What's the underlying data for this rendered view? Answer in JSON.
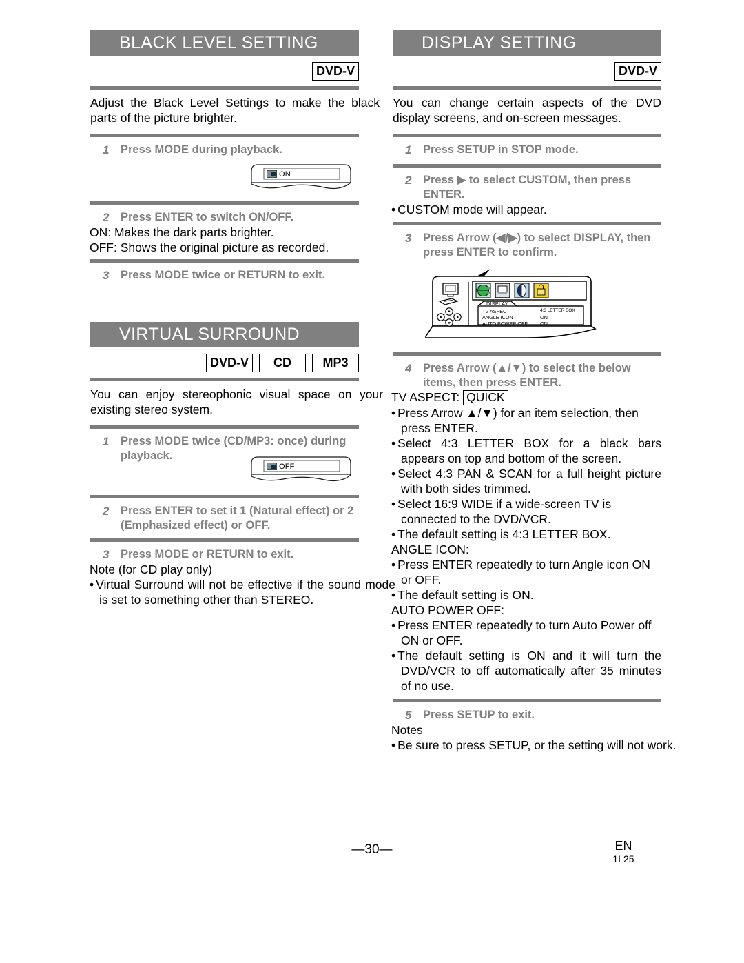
{
  "page": {
    "number": "—30—",
    "region_code": "EN",
    "doc_code": "1L25"
  },
  "left_column": {
    "section1": {
      "title": "BLACK LEVEL SETTING",
      "badges": [
        "DVD-V"
      ],
      "intro": "Adjust the Black Level Settings to make the black parts of the picture brighter.",
      "steps": [
        {
          "num": "1",
          "text": "Press MODE during playback."
        },
        {
          "num": "2",
          "text": "Press ENTER to switch ON/OFF."
        },
        {
          "num": "3",
          "text": "Press MODE twice or RETURN to exit."
        }
      ],
      "osd_callout": {
        "value": "ON",
        "icon": "black-level-chip-icon"
      },
      "notes": [
        "ON: Makes the dark parts brighter.",
        "OFF: Shows the original picture as recorded."
      ]
    },
    "section2": {
      "title": "VIRTUAL SURROUND",
      "badges": [
        "DVD-V",
        "CD",
        "MP3"
      ],
      "intro": "You can enjoy stereophonic visual space on your existing stereo system.",
      "steps": [
        {
          "num": "1",
          "text": "Press MODE twice (CD/MP3: once) during playback."
        },
        {
          "num": "2",
          "text": "Press ENTER to set it 1 (Natural effect) or 2 (Emphasized effect) or OFF."
        },
        {
          "num": "3",
          "text": "Press MODE or RETURN to exit."
        }
      ],
      "osd_callout": {
        "value": "OFF",
        "icon": "virtual-surround-chip-icon"
      },
      "note_heading": "Note (for CD play only)",
      "note_bullets": [
        "Virtual Surround will not be effective if the sound mode is set to something other than STEREO."
      ]
    }
  },
  "right_column": {
    "section": {
      "title": "DISPLAY SETTING",
      "badges": [
        "DVD-V"
      ],
      "intro": "You can change certain aspects of the DVD display screens, and on-screen messages.",
      "steps": [
        {
          "num": "1",
          "text": "Press SETUP in STOP mode."
        },
        {
          "num": "2",
          "text": "Press ▶ to select CUSTOM, then press ENTER."
        },
        {
          "num": "3",
          "text": "Press Arrow (◀/▶) to select DISPLAY, then press ENTER to confirm."
        },
        {
          "num": "4",
          "text": "Press Arrow (▲/▼) to select the below items, then press ENTER."
        },
        {
          "num": "5",
          "text": "Press SETUP to exit."
        }
      ],
      "step2_note": "CUSTOM mode will appear.",
      "osd_diagram": {
        "tab_label": "DISPLAY",
        "icons": [
          "globe-icon",
          "display-icon",
          "audio-icon",
          "lock-icon"
        ],
        "selected_icon": "display-icon",
        "rows": [
          {
            "label": "TV ASPECT",
            "value": "4:3 LETTER BOX"
          },
          {
            "label": "ANGLE ICON",
            "value": "ON"
          },
          {
            "label": "AUTO POWER OFF",
            "value": "ON"
          }
        ]
      },
      "tv_aspect": {
        "label": "TV ASPECT:",
        "badge": "QUICK",
        "bullets": [
          "Press Arrow ▲/▼) for an item selection, then press ENTER.",
          "Select 4:3 LETTER BOX for a black bars appears on top and bottom of the screen.",
          "Select 4:3 PAN & SCAN for a full height picture with both sides trimmed.",
          "Select 16:9 WIDE if a wide-screen TV is connected to the DVD/VCR.",
          "The default setting is 4:3 LETTER BOX."
        ]
      },
      "angle_icon": {
        "label": "ANGLE ICON:",
        "bullets": [
          "Press ENTER repeatedly to turn Angle icon ON or OFF.",
          "The default setting is ON."
        ]
      },
      "auto_power_off": {
        "label": "AUTO POWER OFF:",
        "bullets": [
          "Press ENTER repeatedly to turn Auto Power off ON or OFF.",
          "The default setting is ON and it will turn the DVD/VCR to off automatically after 35 minutes of no use."
        ]
      },
      "notes_heading": "Notes",
      "notes": [
        "Be sure to press SETUP, or the setting will not work."
      ]
    }
  }
}
